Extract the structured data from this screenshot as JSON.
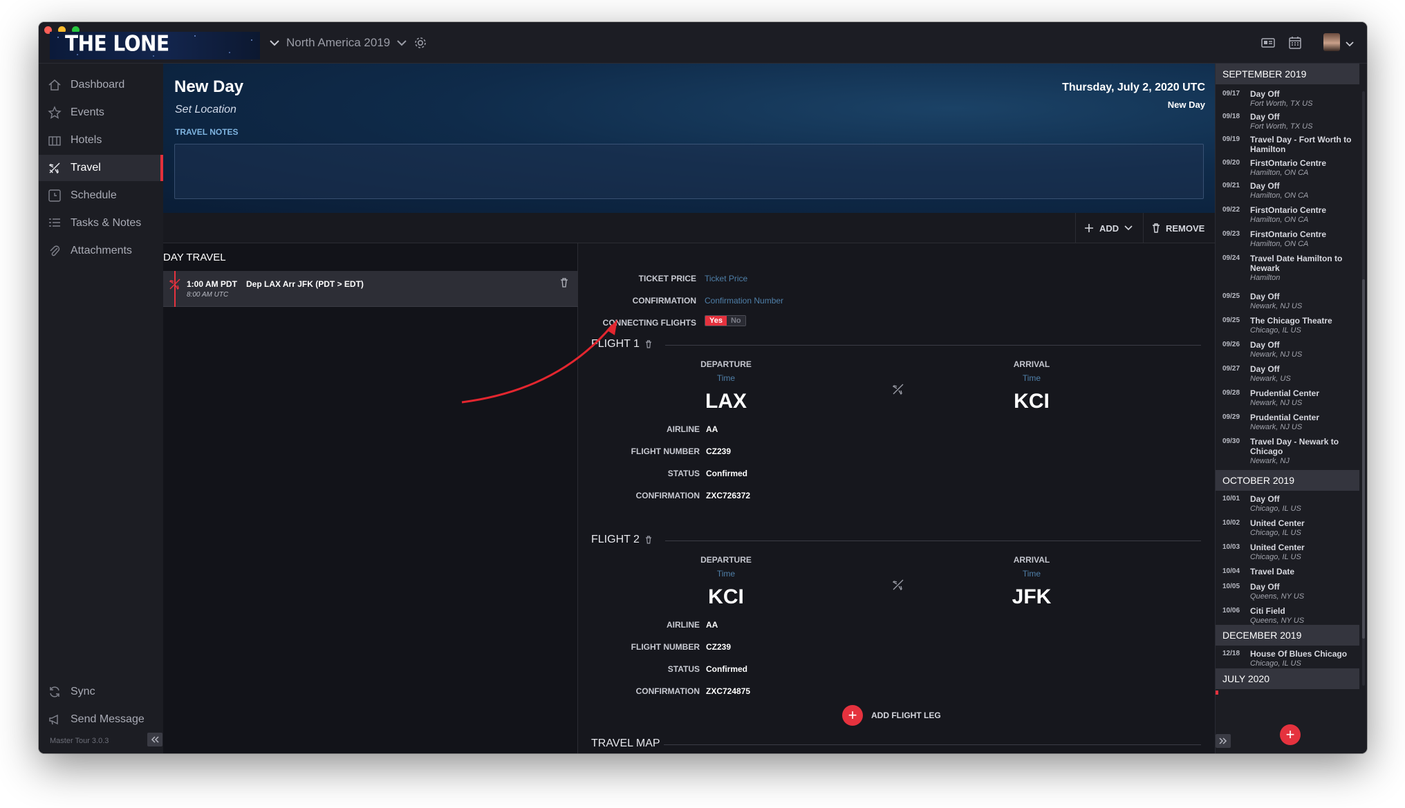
{
  "app": {
    "logo_text": "THE LONE RANGERS",
    "tour": "North America 2019",
    "version": "Master Tour 3.0.3"
  },
  "sidebar": {
    "items": [
      {
        "label": "Dashboard",
        "icon": "home-icon"
      },
      {
        "label": "Events",
        "icon": "star-icon"
      },
      {
        "label": "Hotels",
        "icon": "hotel-icon"
      },
      {
        "label": "Travel",
        "icon": "plane-icon",
        "active": true
      },
      {
        "label": "Schedule",
        "icon": "clock-icon"
      },
      {
        "label": "Tasks & Notes",
        "icon": "list-icon"
      },
      {
        "label": "Attachments",
        "icon": "paperclip-icon"
      }
    ],
    "sync": "Sync",
    "send_message": "Send Message"
  },
  "header": {
    "title": "New Day",
    "location": "Set Location",
    "date": "Thursday, July 2, 2020 UTC",
    "day_type": "New Day",
    "notes_label": "TRAVEL NOTES"
  },
  "toolbar": {
    "add": "ADD",
    "remove": "REMOVE"
  },
  "day_travel": {
    "title": "DAY TRAVEL",
    "item": {
      "time": "1:00 AM PDT",
      "desc": "Dep LAX Arr JFK (PDT > EDT)",
      "utc": "8:00 AM UTC"
    }
  },
  "details": {
    "ticket_price_label": "TICKET PRICE",
    "ticket_price_placeholder": "Ticket Price",
    "confirmation_label": "CONFIRMATION",
    "confirmation_placeholder": "Confirmation Number",
    "connecting_label": "CONNECTING FLIGHTS",
    "yes": "Yes",
    "no": "No",
    "connecting_value": "Yes",
    "departure_label": "DEPARTURE",
    "arrival_label": "ARRIVAL",
    "time_placeholder": "Time",
    "airline_label": "AIRLINE",
    "flight_number_label": "FLIGHT NUMBER",
    "status_label": "STATUS",
    "leg_confirmation_label": "CONFIRMATION",
    "add_flight_leg": "ADD FLIGHT LEG",
    "travel_map": "TRAVEL MAP"
  },
  "flights": [
    {
      "title": "FLIGHT 1",
      "from": "LAX",
      "to": "KCI",
      "airline": "AA",
      "flight_number": "CZ239",
      "status": "Confirmed",
      "confirmation": "ZXC726372"
    },
    {
      "title": "FLIGHT 2",
      "from": "KCI",
      "to": "JFK",
      "airline": "AA",
      "flight_number": "CZ239",
      "status": "Confirmed",
      "confirmation": "ZXC724875"
    }
  ],
  "calendar": {
    "months": [
      "SEPTEMBER 2019",
      "OCTOBER 2019",
      "DECEMBER 2019",
      "JULY 2020"
    ],
    "september": [
      {
        "date": "09/17",
        "title": "Day Off",
        "sub": "Fort Worth, TX US"
      },
      {
        "date": "09/18",
        "title": "Day Off",
        "sub": "Fort Worth, TX US"
      },
      {
        "date": "09/19",
        "title": "Travel Day - Fort Worth to Hamilton",
        "sub": ""
      },
      {
        "date": "09/20",
        "title": "FirstOntario Centre",
        "sub": "Hamilton, ON CA"
      },
      {
        "date": "09/21",
        "title": "Day Off",
        "sub": "Hamilton, ON CA"
      },
      {
        "date": "09/22",
        "title": "FirstOntario Centre",
        "sub": "Hamilton, ON CA"
      },
      {
        "date": "09/23",
        "title": "FirstOntario Centre",
        "sub": "Hamilton, ON CA"
      },
      {
        "date": "09/24",
        "title": "Travel Date Hamilton to Newark",
        "sub": "Hamilton"
      },
      {
        "date": "09/25",
        "title": "Day Off",
        "sub": "Newark, NJ US"
      },
      {
        "date": "09/25",
        "title": "The Chicago Theatre",
        "sub": "Chicago, IL US"
      },
      {
        "date": "09/26",
        "title": "Day Off",
        "sub": "Newark, NJ US"
      },
      {
        "date": "09/27",
        "title": "Day Off",
        "sub": "Newark, US"
      },
      {
        "date": "09/28",
        "title": "Prudential Center",
        "sub": "Newark, NJ US"
      },
      {
        "date": "09/29",
        "title": "Prudential Center",
        "sub": "Newark, NJ US"
      },
      {
        "date": "09/30",
        "title": "Travel Day - Newark to Chicago",
        "sub": "Newark, NJ"
      }
    ],
    "october": [
      {
        "date": "10/01",
        "title": "Day Off",
        "sub": "Chicago, IL US"
      },
      {
        "date": "10/02",
        "title": "United Center",
        "sub": "Chicago, IL US"
      },
      {
        "date": "10/03",
        "title": "United Center",
        "sub": "Chicago, IL US"
      },
      {
        "date": "10/04",
        "title": "Travel Date",
        "sub": ""
      },
      {
        "date": "10/05",
        "title": "Day Off",
        "sub": "Queens, NY US"
      },
      {
        "date": "10/06",
        "title": "Citi Field",
        "sub": "Queens, NY US"
      }
    ],
    "december": [
      {
        "date": "12/18",
        "title": "House Of Blues Chicago",
        "sub": "Chicago, IL US"
      }
    ]
  },
  "colors": {
    "accent": "#e5323e",
    "placeholder": "#4f7fa8",
    "background": "#16171c"
  }
}
